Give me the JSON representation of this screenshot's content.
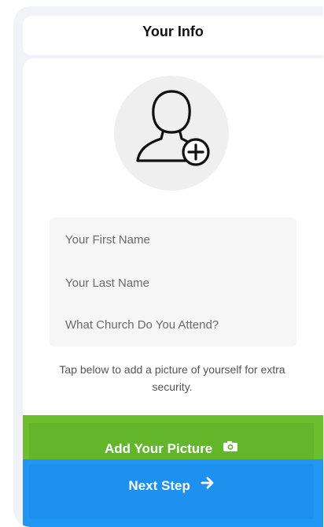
{
  "header": {
    "title": "Your Info"
  },
  "form": {
    "first_name": {
      "value": "",
      "placeholder": "Your First Name"
    },
    "last_name": {
      "value": "",
      "placeholder": "Your Last Name"
    },
    "church": {
      "value": "",
      "placeholder": "What Church Do You Attend?"
    }
  },
  "hint": {
    "text": "Tap below to add a picture of yourself for extra security."
  },
  "buttons": {
    "add_picture_label": "Add Your Picture",
    "add_picture_icon": "camera-icon",
    "next_step_label": "Next Step",
    "next_step_icon": "arrow-right-icon"
  },
  "colors": {
    "background": "#f2f3f7",
    "add_picture_button": "#63b52a",
    "next_step_button": "#1e90ee",
    "avatar_circle": "#efefef",
    "text_dark": "#111111"
  }
}
